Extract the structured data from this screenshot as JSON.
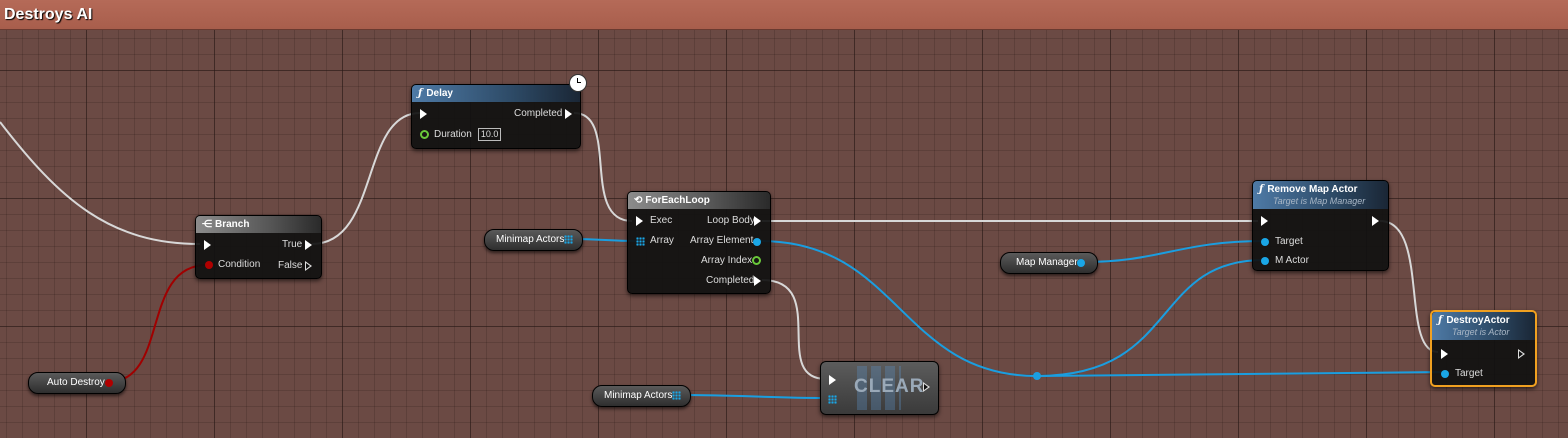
{
  "graph": {
    "title": "Destroys AI"
  },
  "nodes": {
    "delay": {
      "title": "Delay",
      "completed": "Completed",
      "duration_label": "Duration",
      "duration_value": "10.0"
    },
    "branch": {
      "title": "Branch",
      "true_label": "True",
      "condition_label": "Condition",
      "false_label": "False"
    },
    "foreach": {
      "title": "ForEachLoop",
      "exec": "Exec",
      "loop_body": "Loop Body",
      "array": "Array",
      "array_element": "Array Element",
      "array_index": "Array Index",
      "completed": "Completed"
    },
    "remove_map_actor": {
      "title": "Remove Map Actor",
      "subtitle": "Target is Map Manager",
      "target": "Target",
      "m_actor": "M Actor"
    },
    "destroy_actor": {
      "title": "DestroyActor",
      "subtitle": "Target is Actor",
      "target": "Target"
    },
    "clear": {
      "label": "CLEAR"
    }
  },
  "variables": {
    "minimap_actors_1": "Minimap Actors",
    "minimap_actors_2": "Minimap Actors",
    "map_manager": "Map Manager",
    "auto_destroy": "Auto Destroy"
  },
  "colors": {
    "exec_wire": "#d8d8d8",
    "object_wire": "#1a9ee0",
    "bool_wire": "#a00000",
    "selection": "#f0a020",
    "title_bar": "#ad6250"
  },
  "icons": {
    "function": "f-glyph",
    "branch": "branch-icon",
    "loop": "loop-icon",
    "latent": "clock-icon"
  }
}
